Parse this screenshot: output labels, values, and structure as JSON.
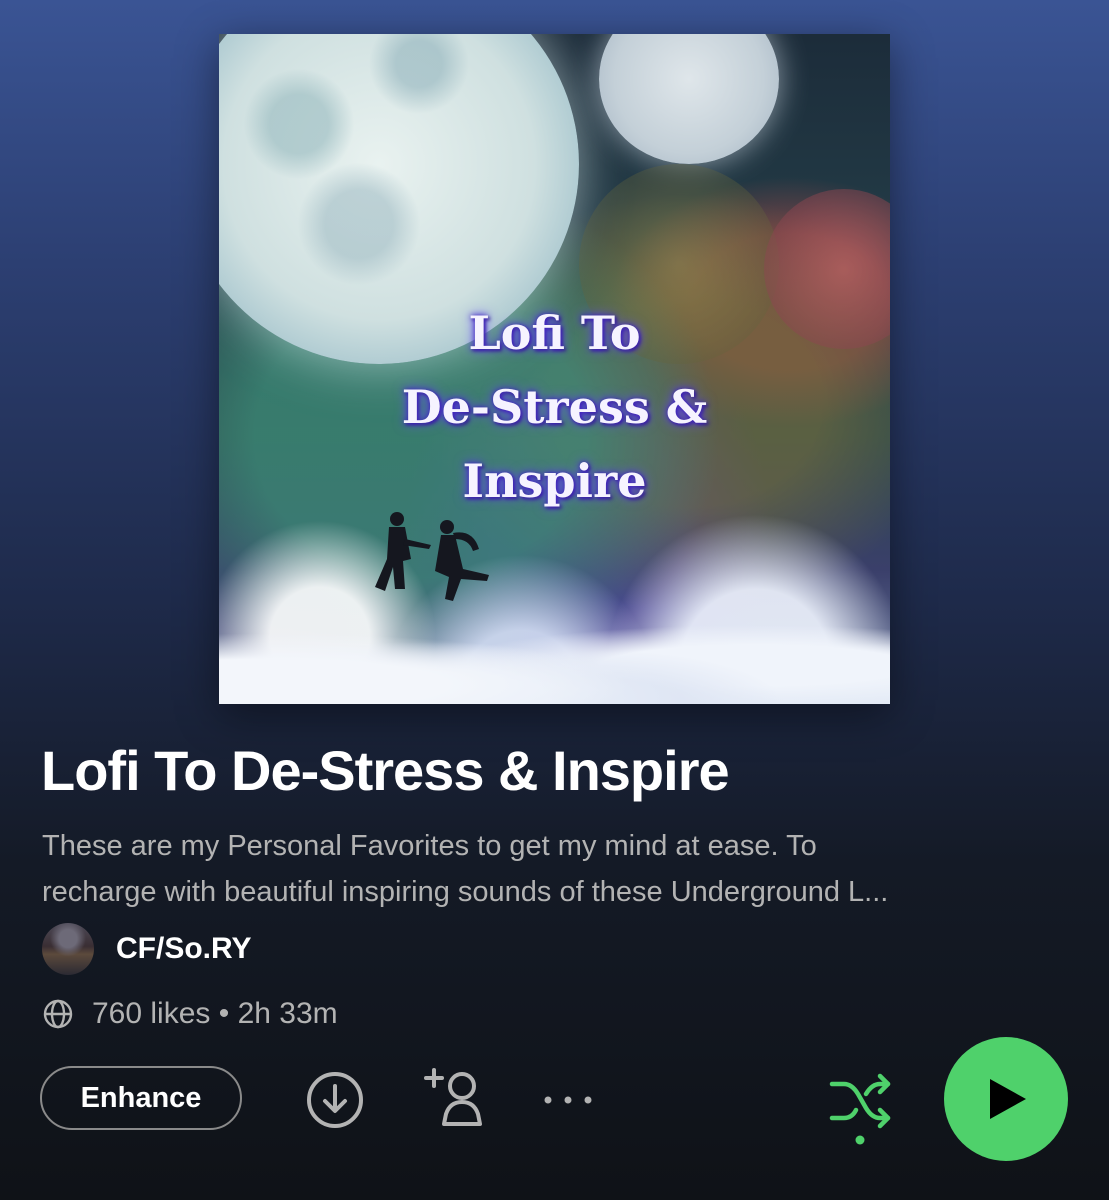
{
  "cover": {
    "lines": [
      "Lofi To",
      "De-Stress &",
      "Inspire"
    ]
  },
  "playlist": {
    "title": "Lofi To De-Stress & Inspire",
    "description_line1": "These are my Personal Favorites to  get my mind at ease. To",
    "description_line2": "recharge with beautiful inspiring sounds of these Underground  L..."
  },
  "owner": {
    "name": "CF/So.RY"
  },
  "meta": {
    "stats": "760 likes • 2h 33m"
  },
  "actions": {
    "enhance_label": "Enhance"
  },
  "icons": {
    "globe": "globe-icon",
    "download": "download-icon",
    "add_user": "add-user-icon",
    "more": "more-icon",
    "shuffle": "shuffle-icon",
    "play": "play-icon"
  },
  "colors": {
    "accent_green": "#4fd16b",
    "text_primary": "#ffffff",
    "text_secondary": "#b3b3b3"
  }
}
